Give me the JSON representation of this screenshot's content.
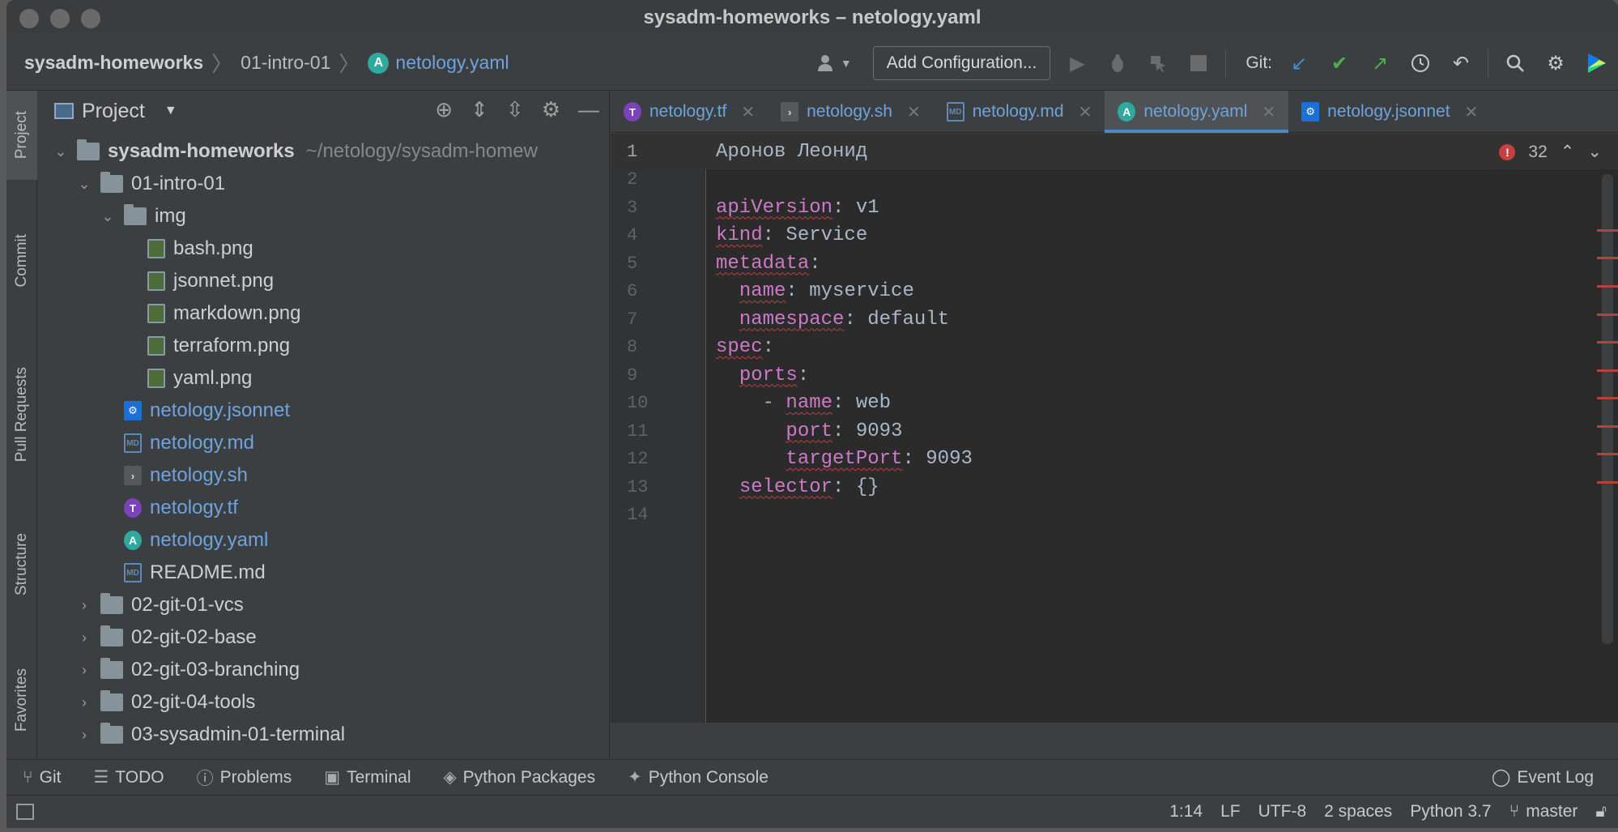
{
  "window": {
    "title": "sysadm-homeworks – netology.yaml"
  },
  "breadcrumb": {
    "root": "sysadm-homeworks",
    "folder": "01-intro-01",
    "file": "netology.yaml"
  },
  "toolbar": {
    "add_config": "Add Configuration...",
    "git_label": "Git:"
  },
  "left_stripe": [
    "Project",
    "Commit",
    "Pull Requests",
    "Structure",
    "Favorites"
  ],
  "project_panel": {
    "title": "Project",
    "tree": [
      {
        "label": "sysadm-homeworks",
        "path": "~/netology/sysadm-homew",
        "type": "folder",
        "open": true,
        "depth": 0,
        "bold": true
      },
      {
        "label": "01-intro-01",
        "type": "folder",
        "open": true,
        "depth": 1
      },
      {
        "label": "img",
        "type": "folder",
        "open": true,
        "depth": 2
      },
      {
        "label": "bash.png",
        "type": "image",
        "depth": 3
      },
      {
        "label": "jsonnet.png",
        "type": "image",
        "depth": 3
      },
      {
        "label": "markdown.png",
        "type": "image",
        "depth": 3
      },
      {
        "label": "terraform.png",
        "type": "image",
        "depth": 3
      },
      {
        "label": "yaml.png",
        "type": "image",
        "depth": 3
      },
      {
        "label": "netology.jsonnet",
        "type": "jsonnet",
        "depth": 2,
        "modified": true
      },
      {
        "label": "netology.md",
        "type": "md",
        "depth": 2,
        "modified": true
      },
      {
        "label": "netology.sh",
        "type": "sh",
        "depth": 2,
        "modified": true
      },
      {
        "label": "netology.tf",
        "type": "tf",
        "depth": 2,
        "modified": true
      },
      {
        "label": "netology.yaml",
        "type": "yaml",
        "depth": 2,
        "modified": true
      },
      {
        "label": "README.md",
        "type": "md",
        "depth": 2
      },
      {
        "label": "02-git-01-vcs",
        "type": "folder",
        "open": false,
        "depth": 1
      },
      {
        "label": "02-git-02-base",
        "type": "folder",
        "open": false,
        "depth": 1
      },
      {
        "label": "02-git-03-branching",
        "type": "folder",
        "open": false,
        "depth": 1
      },
      {
        "label": "02-git-04-tools",
        "type": "folder",
        "open": false,
        "depth": 1
      },
      {
        "label": "03-sysadmin-01-terminal",
        "type": "folder",
        "open": false,
        "depth": 1
      }
    ]
  },
  "tabs": [
    {
      "label": "netology.tf",
      "icon": "terraform-icon",
      "active": false
    },
    {
      "label": "netology.sh",
      "icon": "shell-icon",
      "active": false
    },
    {
      "label": "netology.md",
      "icon": "markdown-icon",
      "active": false
    },
    {
      "label": "netology.yaml",
      "icon": "yaml-icon",
      "active": true
    },
    {
      "label": "netology.jsonnet",
      "icon": "jsonnet-icon",
      "active": false
    }
  ],
  "editor": {
    "problems_count": "32",
    "lines": [
      {
        "n": "1",
        "indent": "",
        "key": "",
        "sep": "",
        "value": "Аронов Леонид"
      },
      {
        "n": "2",
        "indent": "",
        "key": "",
        "sep": "",
        "value": ""
      },
      {
        "n": "3",
        "indent": "",
        "key": "apiVersion",
        "sep": ":",
        "value": " v1"
      },
      {
        "n": "4",
        "indent": "",
        "key": "kind",
        "sep": ":",
        "value": " Service"
      },
      {
        "n": "5",
        "indent": "",
        "key": "metadata",
        "sep": ":",
        "value": ""
      },
      {
        "n": "6",
        "indent": "  ",
        "key": "name",
        "sep": ":",
        "value": " myservice"
      },
      {
        "n": "7",
        "indent": "  ",
        "key": "namespace",
        "sep": ":",
        "value": " default"
      },
      {
        "n": "8",
        "indent": "",
        "key": "spec",
        "sep": ":",
        "value": ""
      },
      {
        "n": "9",
        "indent": "  ",
        "key": "ports",
        "sep": ":",
        "value": ""
      },
      {
        "n": "10",
        "indent": "    - ",
        "key": "name",
        "sep": ":",
        "value": " web"
      },
      {
        "n": "11",
        "indent": "      ",
        "key": "port",
        "sep": ":",
        "value": " 9093"
      },
      {
        "n": "12",
        "indent": "      ",
        "key": "targetPort",
        "sep": ":",
        "value": " 9093"
      },
      {
        "n": "13",
        "indent": "  ",
        "key": "selector",
        "sep": ":",
        "value": " {}"
      },
      {
        "n": "14",
        "indent": "",
        "key": "",
        "sep": "",
        "value": ""
      }
    ]
  },
  "bottom_tools": [
    "Git",
    "TODO",
    "Problems",
    "Terminal",
    "Python Packages",
    "Python Console"
  ],
  "event_log": "Event Log",
  "status": {
    "position": "1:14",
    "line_sep": "LF",
    "encoding": "UTF-8",
    "indent": "2 spaces",
    "interpreter": "Python 3.7",
    "branch": "master"
  }
}
